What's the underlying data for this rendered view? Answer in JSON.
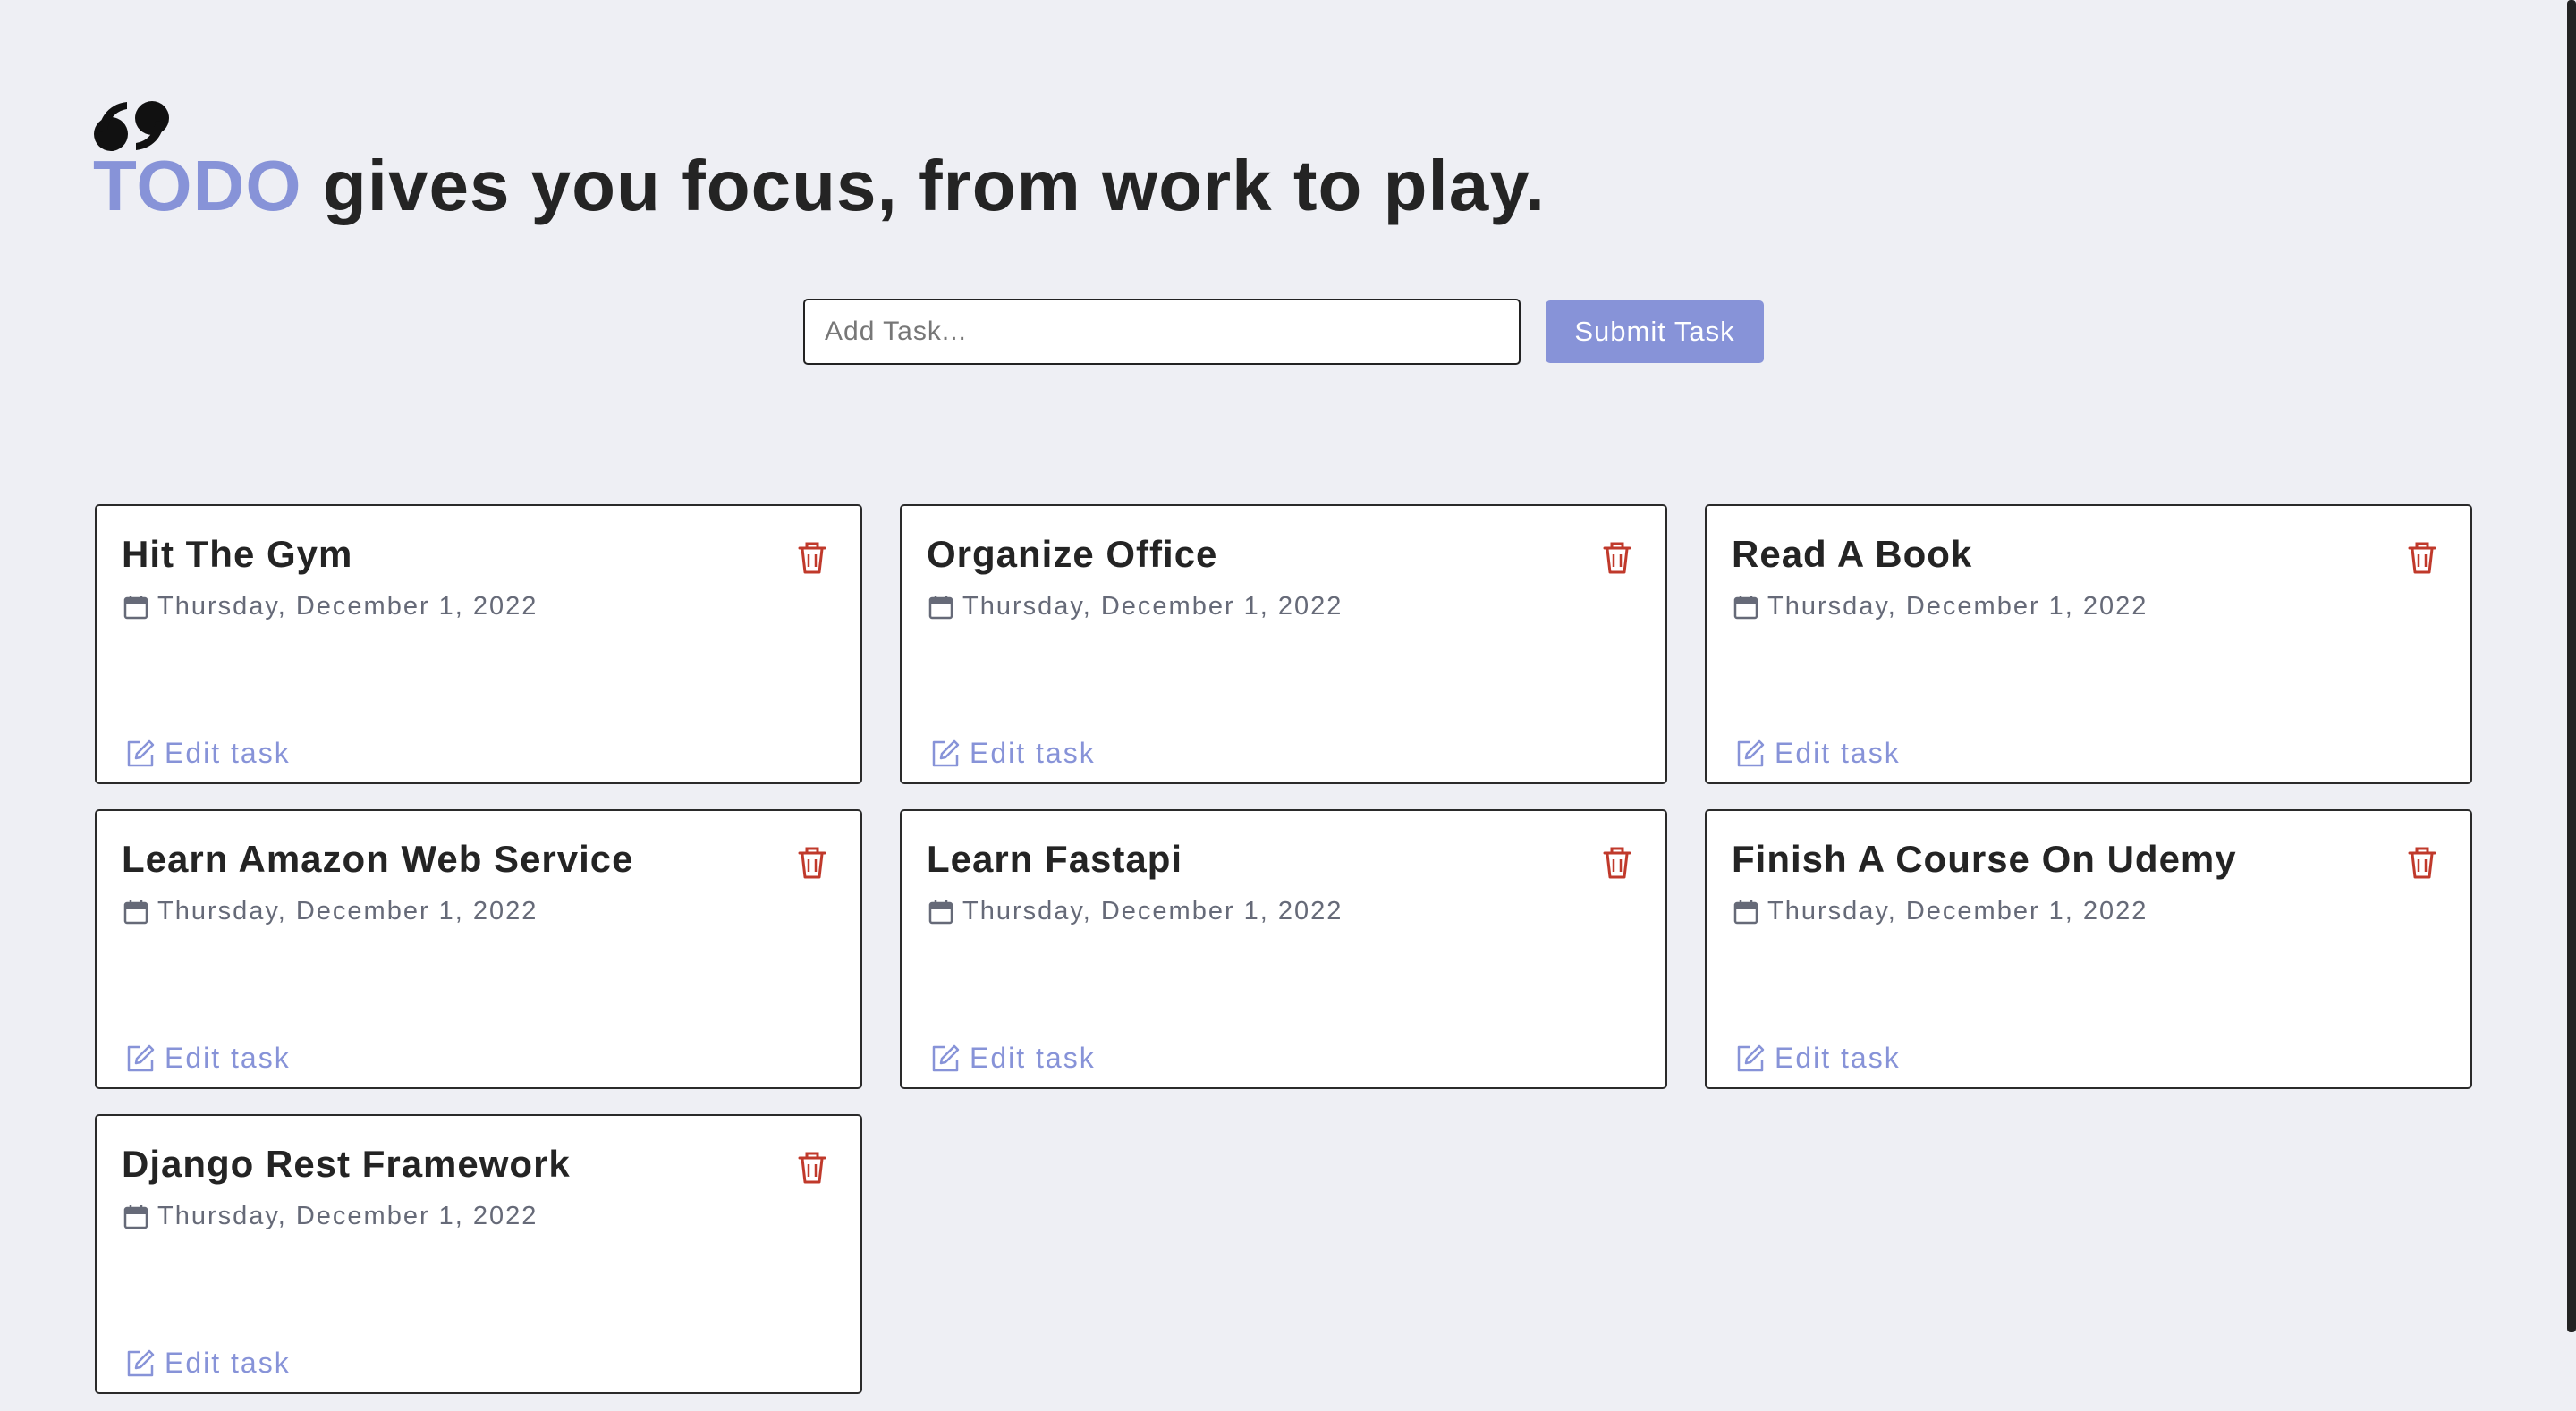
{
  "header": {
    "accent_word": "TODO",
    "tagline": " gives you focus, from work to play.",
    "accent_color": "#8793d8"
  },
  "form": {
    "input_placeholder": "Add Task...",
    "input_value": "",
    "submit_label": "Submit Task"
  },
  "icons": {
    "quote": "quote-icon",
    "trash": "trash-icon",
    "calendar": "calendar-icon",
    "edit": "edit-icon"
  },
  "tasks": [
    {
      "title": "Hit The Gym",
      "date": "Thursday, December 1, 2022",
      "edit_label": "Edit task"
    },
    {
      "title": "Organize Office",
      "date": "Thursday, December 1, 2022",
      "edit_label": "Edit task"
    },
    {
      "title": "Read A Book",
      "date": "Thursday, December 1, 2022",
      "edit_label": "Edit task"
    },
    {
      "title": "Learn Amazon Web Service",
      "date": "Thursday, December 1, 2022",
      "edit_label": "Edit task"
    },
    {
      "title": "Learn Fastapi",
      "date": "Thursday, December 1, 2022",
      "edit_label": "Edit task"
    },
    {
      "title": "Finish A Course On Udemy",
      "date": "Thursday, December 1, 2022",
      "edit_label": "Edit task"
    },
    {
      "title": "Django Rest Framework",
      "date": "Thursday, December 1, 2022",
      "edit_label": "Edit task"
    }
  ],
  "colors": {
    "background": "#eeeff4",
    "delete": "#c0392b",
    "muted_text": "#666a78"
  }
}
